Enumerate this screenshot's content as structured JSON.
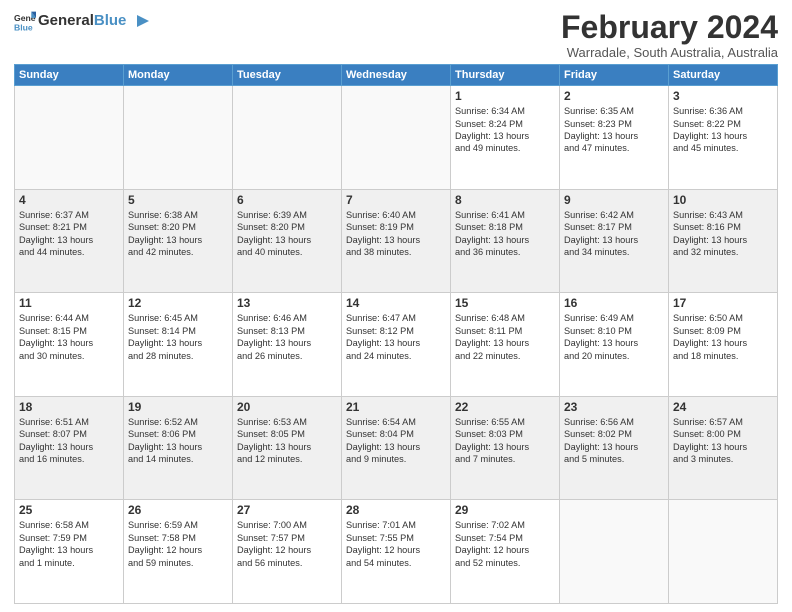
{
  "header": {
    "logo_general": "General",
    "logo_blue": "Blue",
    "month_year": "February 2024",
    "location": "Warradale, South Australia, Australia"
  },
  "weekdays": [
    "Sunday",
    "Monday",
    "Tuesday",
    "Wednesday",
    "Thursday",
    "Friday",
    "Saturday"
  ],
  "weeks": [
    [
      {
        "day": "",
        "detail": ""
      },
      {
        "day": "",
        "detail": ""
      },
      {
        "day": "",
        "detail": ""
      },
      {
        "day": "",
        "detail": ""
      },
      {
        "day": "1",
        "detail": "Sunrise: 6:34 AM\nSunset: 8:24 PM\nDaylight: 13 hours\nand 49 minutes."
      },
      {
        "day": "2",
        "detail": "Sunrise: 6:35 AM\nSunset: 8:23 PM\nDaylight: 13 hours\nand 47 minutes."
      },
      {
        "day": "3",
        "detail": "Sunrise: 6:36 AM\nSunset: 8:22 PM\nDaylight: 13 hours\nand 45 minutes."
      }
    ],
    [
      {
        "day": "4",
        "detail": "Sunrise: 6:37 AM\nSunset: 8:21 PM\nDaylight: 13 hours\nand 44 minutes."
      },
      {
        "day": "5",
        "detail": "Sunrise: 6:38 AM\nSunset: 8:20 PM\nDaylight: 13 hours\nand 42 minutes."
      },
      {
        "day": "6",
        "detail": "Sunrise: 6:39 AM\nSunset: 8:20 PM\nDaylight: 13 hours\nand 40 minutes."
      },
      {
        "day": "7",
        "detail": "Sunrise: 6:40 AM\nSunset: 8:19 PM\nDaylight: 13 hours\nand 38 minutes."
      },
      {
        "day": "8",
        "detail": "Sunrise: 6:41 AM\nSunset: 8:18 PM\nDaylight: 13 hours\nand 36 minutes."
      },
      {
        "day": "9",
        "detail": "Sunrise: 6:42 AM\nSunset: 8:17 PM\nDaylight: 13 hours\nand 34 minutes."
      },
      {
        "day": "10",
        "detail": "Sunrise: 6:43 AM\nSunset: 8:16 PM\nDaylight: 13 hours\nand 32 minutes."
      }
    ],
    [
      {
        "day": "11",
        "detail": "Sunrise: 6:44 AM\nSunset: 8:15 PM\nDaylight: 13 hours\nand 30 minutes."
      },
      {
        "day": "12",
        "detail": "Sunrise: 6:45 AM\nSunset: 8:14 PM\nDaylight: 13 hours\nand 28 minutes."
      },
      {
        "day": "13",
        "detail": "Sunrise: 6:46 AM\nSunset: 8:13 PM\nDaylight: 13 hours\nand 26 minutes."
      },
      {
        "day": "14",
        "detail": "Sunrise: 6:47 AM\nSunset: 8:12 PM\nDaylight: 13 hours\nand 24 minutes."
      },
      {
        "day": "15",
        "detail": "Sunrise: 6:48 AM\nSunset: 8:11 PM\nDaylight: 13 hours\nand 22 minutes."
      },
      {
        "day": "16",
        "detail": "Sunrise: 6:49 AM\nSunset: 8:10 PM\nDaylight: 13 hours\nand 20 minutes."
      },
      {
        "day": "17",
        "detail": "Sunrise: 6:50 AM\nSunset: 8:09 PM\nDaylight: 13 hours\nand 18 minutes."
      }
    ],
    [
      {
        "day": "18",
        "detail": "Sunrise: 6:51 AM\nSunset: 8:07 PM\nDaylight: 13 hours\nand 16 minutes."
      },
      {
        "day": "19",
        "detail": "Sunrise: 6:52 AM\nSunset: 8:06 PM\nDaylight: 13 hours\nand 14 minutes."
      },
      {
        "day": "20",
        "detail": "Sunrise: 6:53 AM\nSunset: 8:05 PM\nDaylight: 13 hours\nand 12 minutes."
      },
      {
        "day": "21",
        "detail": "Sunrise: 6:54 AM\nSunset: 8:04 PM\nDaylight: 13 hours\nand 9 minutes."
      },
      {
        "day": "22",
        "detail": "Sunrise: 6:55 AM\nSunset: 8:03 PM\nDaylight: 13 hours\nand 7 minutes."
      },
      {
        "day": "23",
        "detail": "Sunrise: 6:56 AM\nSunset: 8:02 PM\nDaylight: 13 hours\nand 5 minutes."
      },
      {
        "day": "24",
        "detail": "Sunrise: 6:57 AM\nSunset: 8:00 PM\nDaylight: 13 hours\nand 3 minutes."
      }
    ],
    [
      {
        "day": "25",
        "detail": "Sunrise: 6:58 AM\nSunset: 7:59 PM\nDaylight: 13 hours\nand 1 minute."
      },
      {
        "day": "26",
        "detail": "Sunrise: 6:59 AM\nSunset: 7:58 PM\nDaylight: 12 hours\nand 59 minutes."
      },
      {
        "day": "27",
        "detail": "Sunrise: 7:00 AM\nSunset: 7:57 PM\nDaylight: 12 hours\nand 56 minutes."
      },
      {
        "day": "28",
        "detail": "Sunrise: 7:01 AM\nSunset: 7:55 PM\nDaylight: 12 hours\nand 54 minutes."
      },
      {
        "day": "29",
        "detail": "Sunrise: 7:02 AM\nSunset: 7:54 PM\nDaylight: 12 hours\nand 52 minutes."
      },
      {
        "day": "",
        "detail": ""
      },
      {
        "day": "",
        "detail": ""
      }
    ]
  ]
}
